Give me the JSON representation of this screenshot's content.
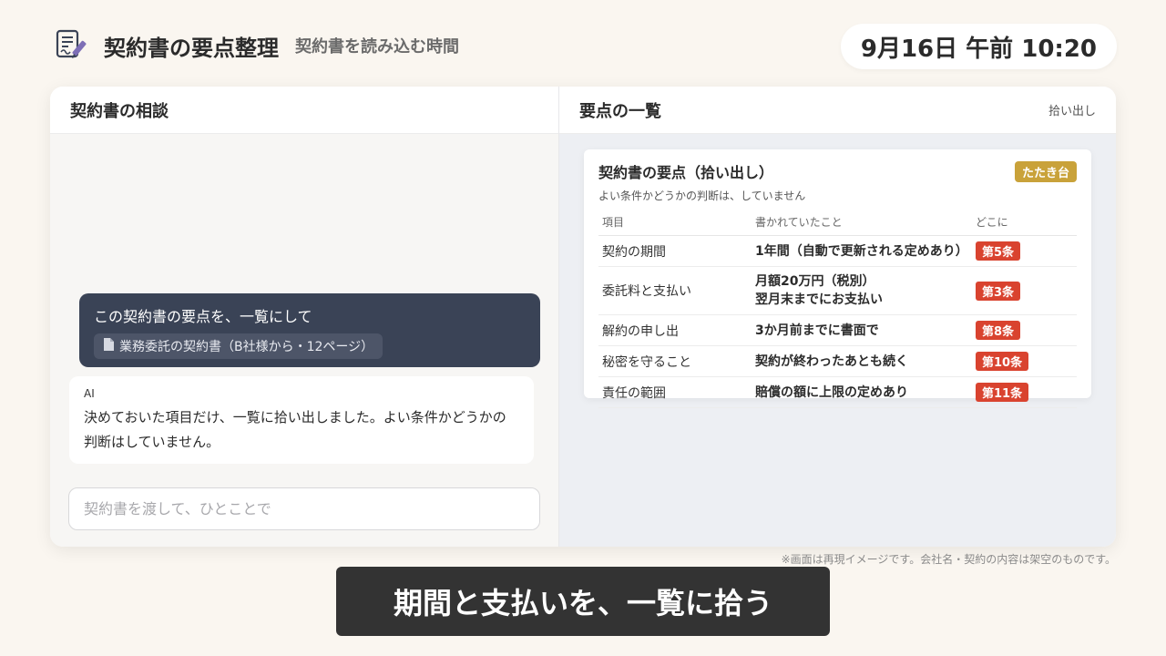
{
  "header": {
    "title": "契約書の要点整理",
    "subtitle": "契約書を読み込む時間",
    "clock": "9月16日 午前 10:20"
  },
  "chat": {
    "title": "契約書の相談",
    "user_message": "この契約書の要点を、一覧にして",
    "attachment": "業務委託の契約書（B社様から・12ページ）",
    "ai_label": "AI",
    "ai_message": "決めておいた項目だけ、一覧に拾い出しました。よい条件かどうかの判断はしていません。",
    "input_placeholder": "契約書を渡して、ひとことで"
  },
  "summary": {
    "pane_title": "要点の一覧",
    "pane_action": "拾い出し",
    "card_title": "契約書の要点（拾い出し）",
    "badge": "たたき台",
    "note": "よい条件かどうかの判断は、していません",
    "columns": [
      "項目",
      "書かれていたこと",
      "どこに"
    ],
    "rows": [
      {
        "item": "契約の期間",
        "written": "1年間（自動で更新される定めあり）",
        "where": "第5条"
      },
      {
        "item": "委託料と支払い",
        "written": "月額20万円（税別）\n翌月末までにお支払い",
        "where": "第3条"
      },
      {
        "item": "解約の申し出",
        "written": "3か月前までに書面で",
        "where": "第8条"
      },
      {
        "item": "秘密を守ること",
        "written": "契約が終わったあとも続く",
        "where": "第10条"
      },
      {
        "item": "責任の範囲",
        "written": "賠償の額に上限の定めあり",
        "where": "第11条"
      }
    ]
  },
  "footer": {
    "disclaimer": "※画面は再現イメージです。会社名・契約の内容は架空のものです。",
    "caption": "期間と支払いを、一覧に拾う"
  },
  "colors": {
    "user_bubble": "#3a4356",
    "badge": "#c9a23a",
    "article_tag": "#d9432f"
  }
}
